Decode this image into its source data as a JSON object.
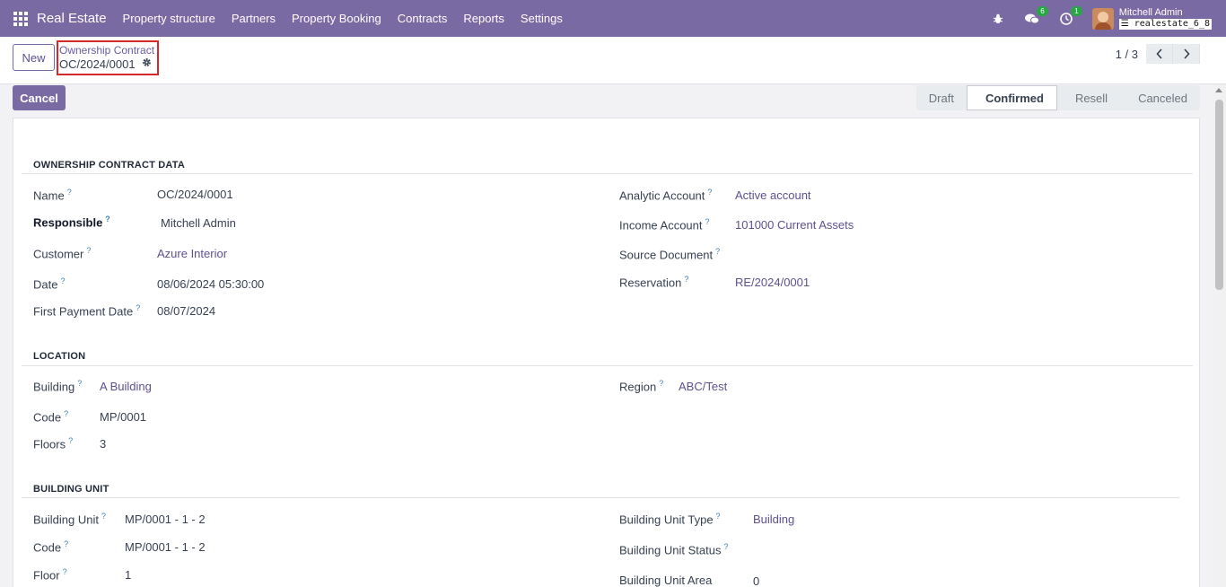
{
  "navbar": {
    "brand": "Real Estate",
    "menu": [
      "Property structure",
      "Partners",
      "Property Booking",
      "Contracts",
      "Reports",
      "Settings"
    ],
    "messages_count": "6",
    "activities_count": "1",
    "user_name": "Mitchell Admin",
    "db_name": "realestate_6_8"
  },
  "control": {
    "new_label": "New",
    "breadcrumb_parent": "Ownership Contract",
    "breadcrumb_current": "OC/2024/0001",
    "pager": "1 / 3"
  },
  "actions": {
    "cancel_label": "Cancel"
  },
  "status": {
    "stages": [
      "Draft",
      "Confirmed",
      "Resell",
      "Canceled"
    ],
    "active": "Confirmed"
  },
  "sections": {
    "contract": {
      "title": "OWNERSHIP CONTRACT DATA",
      "left": [
        {
          "label": "Name",
          "value": "OC/2024/0001",
          "link": false,
          "bold": false
        },
        {
          "label": "Responsible",
          "value": "Mitchell Admin",
          "link": false,
          "bold": true
        },
        {
          "label": "Customer",
          "value": "Azure Interior",
          "link": true,
          "bold": false
        },
        {
          "label": "Date",
          "value": "08/06/2024 05:30:00",
          "link": false,
          "bold": false
        },
        {
          "label": "First Payment Date",
          "value": "08/07/2024",
          "link": false,
          "bold": false
        }
      ],
      "right": [
        {
          "label": "Analytic Account",
          "value": "Active account",
          "link": true
        },
        {
          "label": "Income Account",
          "value": "101000 Current Assets",
          "link": true
        },
        {
          "label": "Source Document",
          "value": "",
          "link": false
        },
        {
          "label": "Reservation",
          "value": "RE/2024/0001",
          "link": true
        }
      ]
    },
    "location": {
      "title": "LOCATION",
      "left": [
        {
          "label": "Building",
          "value": "A Building",
          "link": true
        },
        {
          "label": "Code",
          "value": "MP/0001",
          "link": false
        },
        {
          "label": "Floors",
          "value": "3",
          "link": false
        }
      ],
      "right": [
        {
          "label": "Region",
          "value": "ABC/Test",
          "link": true
        }
      ]
    },
    "unit": {
      "title": "BUILDING UNIT",
      "left": [
        {
          "label": "Building Unit",
          "value": "MP/0001 - 1 - 2",
          "link": false
        },
        {
          "label": "Code",
          "value": "MP/0001 - 1 - 2",
          "link": false
        },
        {
          "label": "Floor",
          "value": "1",
          "link": false
        }
      ],
      "right": [
        {
          "label": "Building Unit Type",
          "value": "Building",
          "link": true
        },
        {
          "label": "Building Unit Status",
          "value": "",
          "link": false
        },
        {
          "label": "Building Unit Area",
          "value": "0",
          "link": false
        }
      ]
    }
  }
}
